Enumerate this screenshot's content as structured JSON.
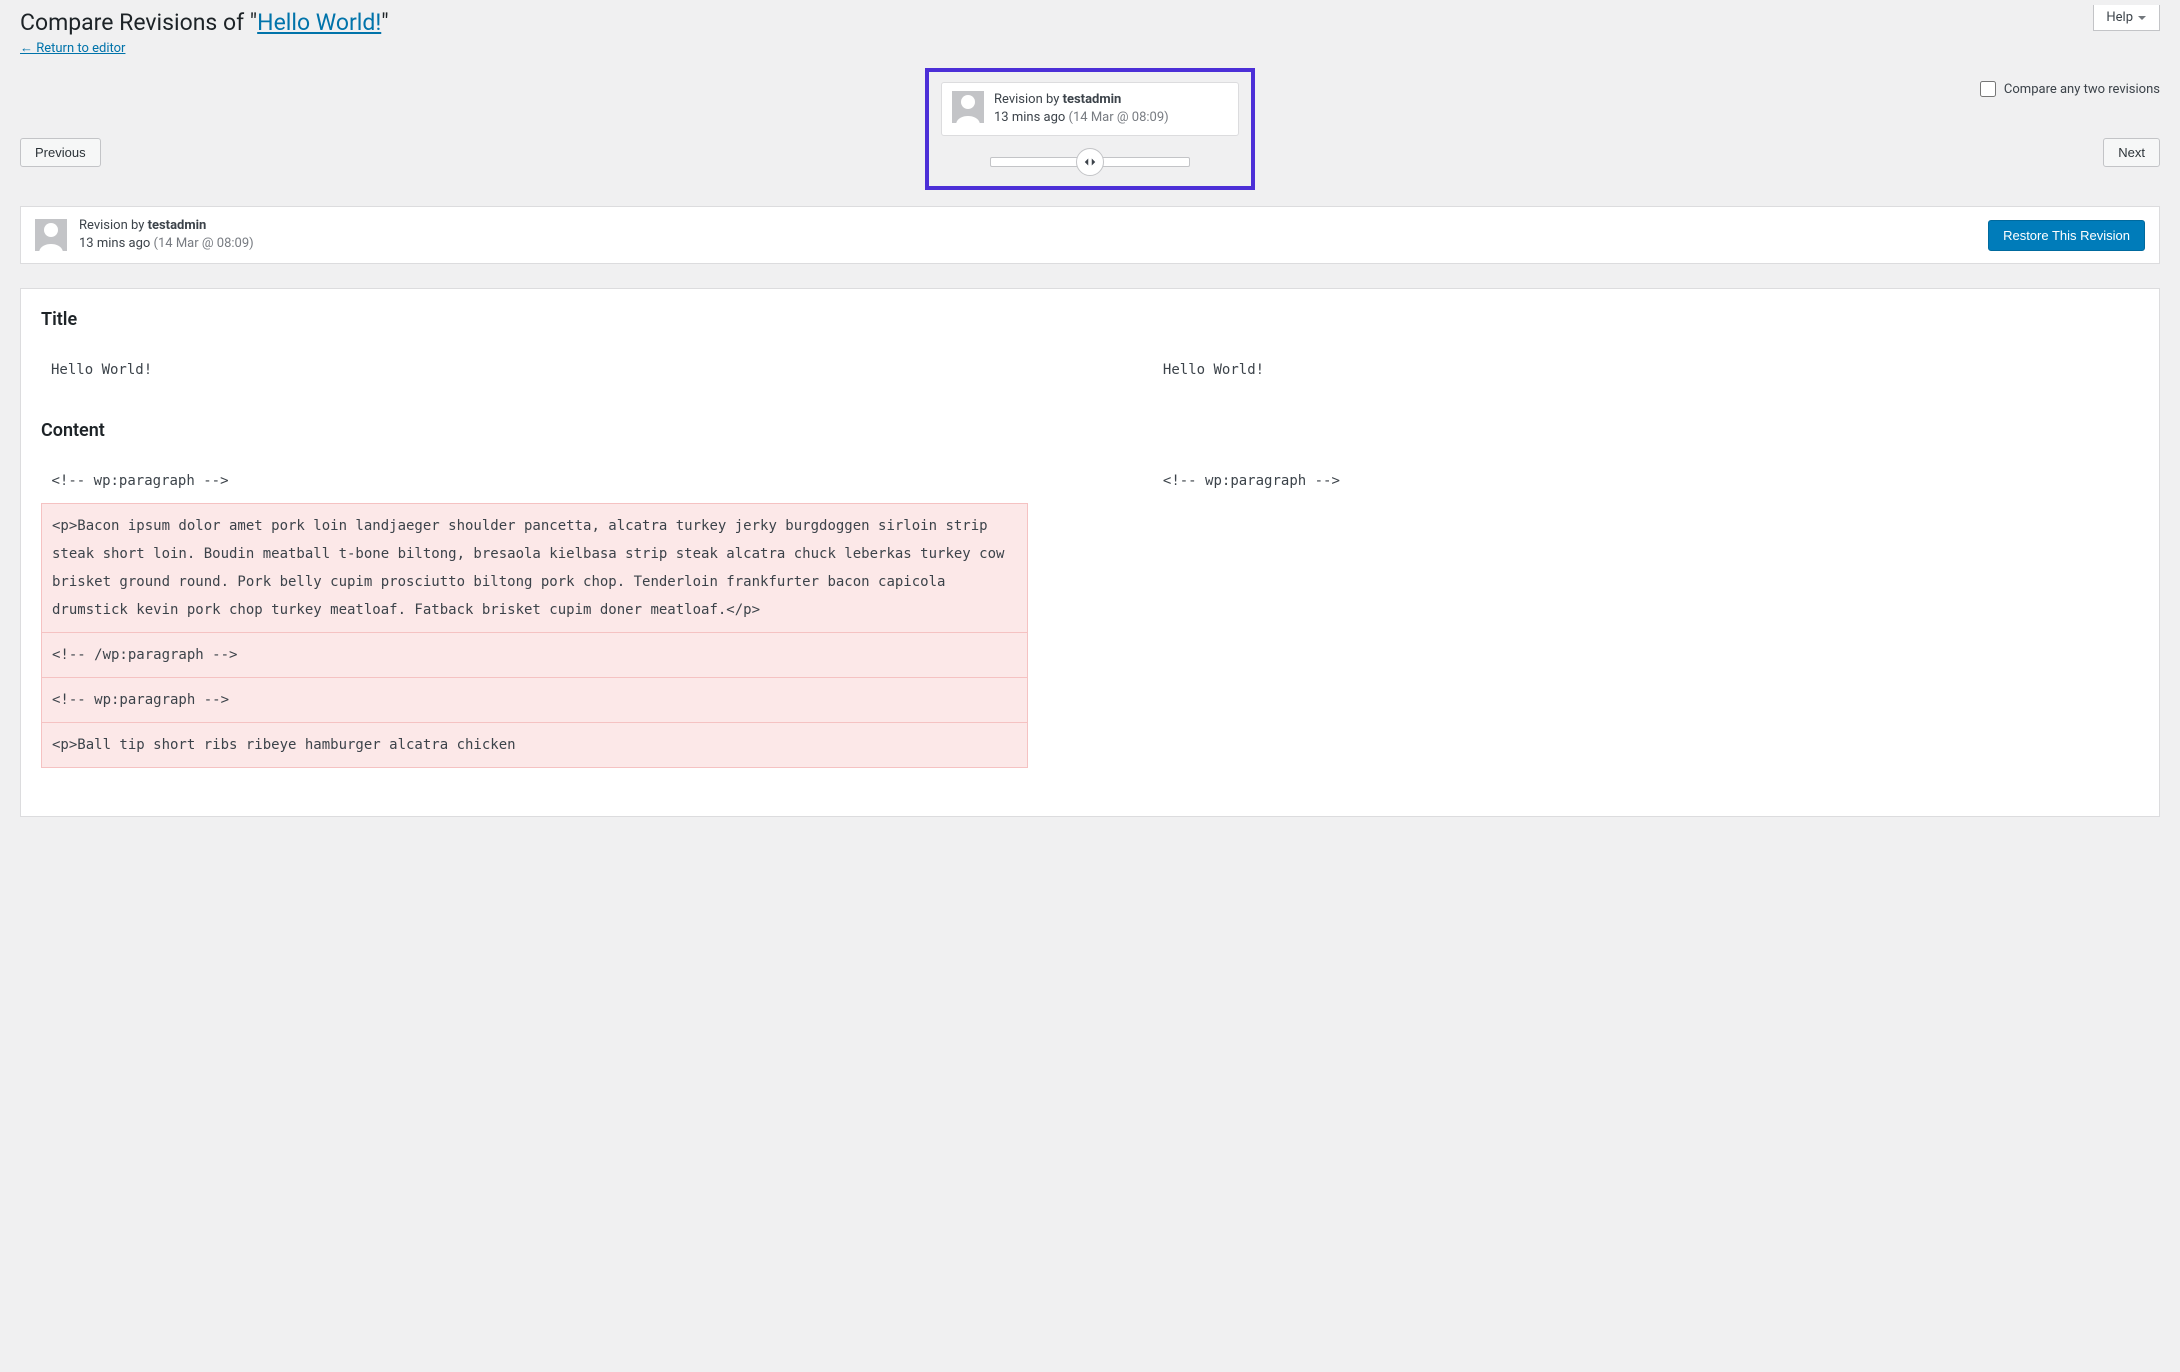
{
  "help": {
    "label": "Help"
  },
  "page": {
    "title_prefix": "Compare Revisions of \"",
    "title_link": "Hello World!",
    "title_suffix": "\"",
    "return_link": "← Return to editor"
  },
  "controls": {
    "previous": "Previous",
    "next": "Next",
    "compare_label": "Compare any two revisions"
  },
  "tooltip": {
    "by_prefix": "Revision by ",
    "author": "testadmin",
    "ago": "13 mins ago",
    "date": "(14 Mar @ 08:09)"
  },
  "meta": {
    "by_prefix": "Revision by ",
    "author": "testadmin",
    "ago": "13 mins ago",
    "date": "(14 Mar @ 08:09)",
    "restore": "Restore This Revision"
  },
  "diff": {
    "title_heading": "Title",
    "content_heading": "Content",
    "title_left": "Hello World!",
    "title_right": "Hello World!",
    "rows": [
      {
        "type": "context",
        "left": "<!-- wp:paragraph -->",
        "right": "<!-- wp:paragraph -->"
      },
      {
        "type": "deleted",
        "left": "<p>Bacon ipsum dolor amet pork loin landjaeger shoulder pancetta, alcatra turkey jerky burgdoggen sirloin strip steak short loin. Boudin meatball t-bone biltong, bresaola kielbasa strip steak alcatra chuck leberkas turkey cow brisket ground round. Pork belly cupim prosciutto biltong pork chop. Tenderloin frankfurter bacon capicola drumstick kevin pork chop turkey meatloaf. Fatback brisket cupim doner meatloaf.</p>",
        "right": ""
      },
      {
        "type": "deleted",
        "left": "<!-- /wp:paragraph -->",
        "right": ""
      },
      {
        "type": "deleted",
        "left": "<!-- wp:paragraph -->",
        "right": ""
      },
      {
        "type": "deleted-partial",
        "left": "<p>Ball tip short ribs ribeye hamburger alcatra chicken",
        "right": ""
      }
    ]
  }
}
